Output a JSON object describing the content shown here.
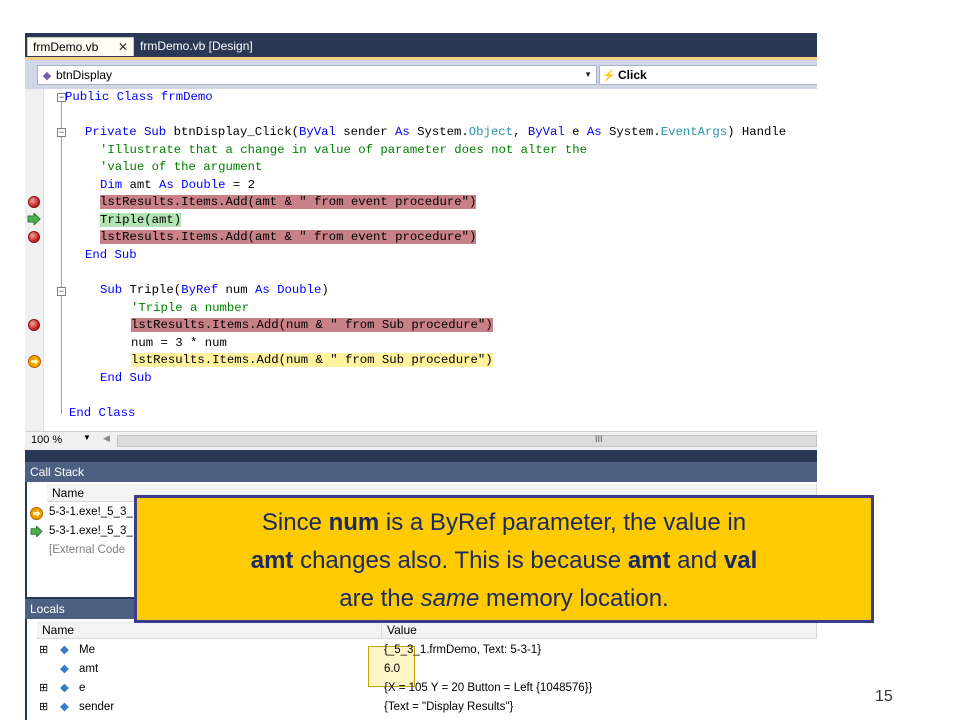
{
  "tabs": [
    {
      "label": "frmDemo.vb",
      "close": "✕"
    },
    {
      "label": "frmDemo.vb [Design]"
    }
  ],
  "nav": {
    "object": "btnDisplay",
    "event": "Click"
  },
  "code": {
    "l1": "Public Class frmDemo",
    "l2_kw1": "Private Sub ",
    "l2_name": "btnDisplay_Click(",
    "l2_kw2": "ByVal",
    "l2_a": " sender ",
    "l2_kw3": "As",
    "l2_b": " System.",
    "l2_t1": "Object",
    "l2_c": ", ",
    "l2_kw4": "ByVal",
    "l2_d": " e ",
    "l2_kw5": "As",
    "l2_e": " System.",
    "l2_t2": "EventArgs",
    "l2_f": ") Handle",
    "l3": "'Illustrate that a change in value of parameter does not alter the",
    "l4": "'value of the argument",
    "l5_kw1": "Dim",
    "l5_a": " amt ",
    "l5_kw2": "As Double",
    "l5_b": " = 2",
    "l6": "lstResults.Items.Add(amt & \" from event procedure\")",
    "l7": "Triple(amt)",
    "l8": "lstResults.Items.Add(amt & \" from event procedure\")",
    "l9": "End Sub",
    "l10_kw1": "Sub",
    "l10_a": " Triple(",
    "l10_kw2": "ByRef",
    "l10_b": " num ",
    "l10_kw3": "As Double",
    "l10_c": ")",
    "l11": "'Triple a number",
    "l12": "lstResults.Items.Add(num & \" from Sub procedure\")",
    "l13": "num = 3 * num",
    "l14": "lstResults.Items.Add(num & \" from Sub procedure\")",
    "l15": "End Sub",
    "l16": "End Class"
  },
  "status": {
    "zoom": "100 %",
    "scroll_grip": "III"
  },
  "callstack": {
    "title": "Call Stack",
    "col_name": "Name",
    "rows": [
      "5-3-1.exe!_5_3_",
      "5-3-1.exe!_5_3_",
      "[External Code"
    ]
  },
  "locals": {
    "title": "Locals",
    "col_name": "Name",
    "col_value": "Value",
    "rows": [
      {
        "expander": "⊞",
        "name": "Me",
        "value": "{_5_3_1.frmDemo, Text: 5-3-1}"
      },
      {
        "expander": "",
        "name": "amt",
        "value": "6.0"
      },
      {
        "expander": "⊞",
        "name": "e",
        "value": "{X = 105 Y = 20 Button = Left {1048576}}"
      },
      {
        "expander": "⊞",
        "name": "sender",
        "value": "{Text = \"Display Results\"}"
      }
    ]
  },
  "callout": {
    "p1": "Since ",
    "b1": "num",
    "p2": " is a ByRef parameter,  the value in",
    "b2": "amt",
    "p3": " changes also. This is because ",
    "b3": "amt",
    "p4": " and ",
    "b4": "val",
    "p5": "are the ",
    "i1": "same",
    "p6": " memory location."
  },
  "page_number": "15"
}
